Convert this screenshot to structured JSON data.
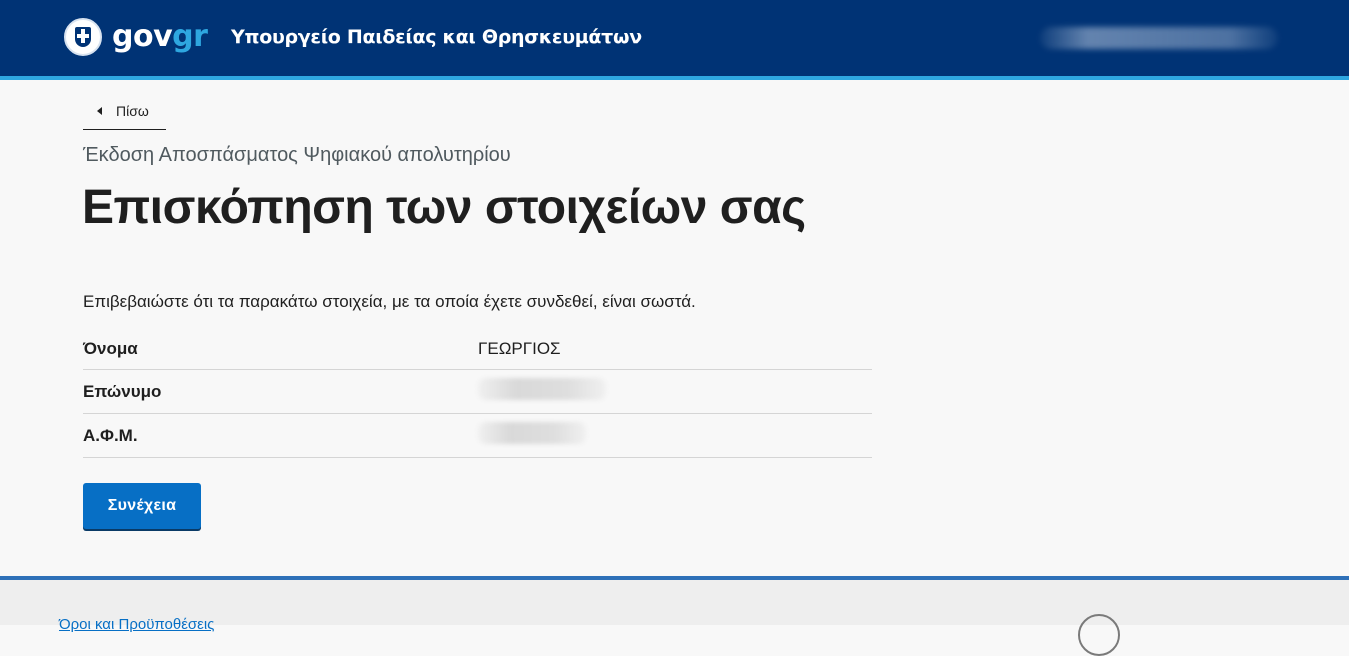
{
  "header": {
    "logo_gov": "gov",
    "logo_gr": "gr",
    "ministry": "Υπουργείο Παιδείας και Θρησκευμάτων",
    "colors": {
      "bar": "#003375",
      "accent": "#2ea7e0"
    }
  },
  "nav": {
    "back_label": "Πίσω"
  },
  "page": {
    "caption": "Έκδοση Αποσπάσματος Ψηφιακού απολυτηρίου",
    "title": "Επισκόπηση των στοιχείων σας",
    "instructions": "Επιβεβαιώστε ότι τα παρακάτω στοιχεία, με τα οποία έχετε συνδεθεί, είναι σωστά."
  },
  "summary": [
    {
      "key": "Όνομα",
      "value": "ΓΕΩΡΓΙΟΣ"
    },
    {
      "key": "Επώνυμο",
      "value": ""
    },
    {
      "key": "Α.Φ.Μ.",
      "value": ""
    }
  ],
  "actions": {
    "continue_label": "Συνέχεια",
    "button_color": "#076fc5"
  },
  "footer": {
    "terms_link": "Όροι και Προϋποθέσεις"
  }
}
